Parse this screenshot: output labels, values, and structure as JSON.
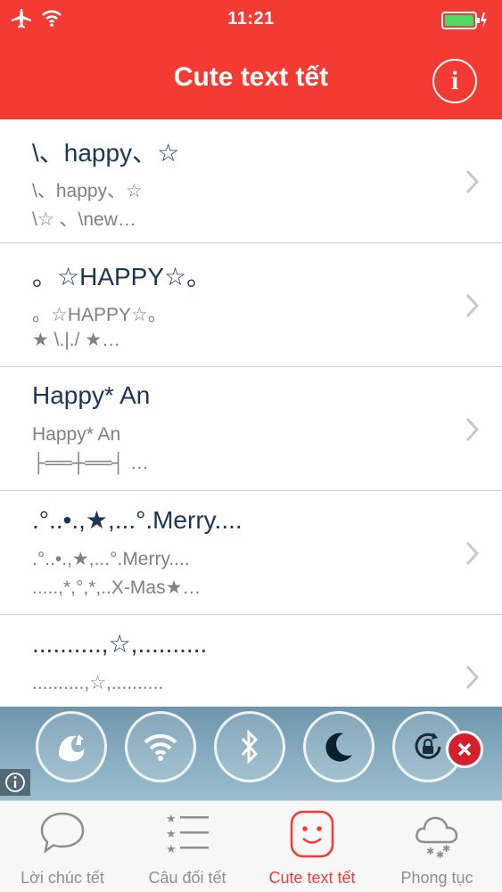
{
  "status": {
    "time": "11:21"
  },
  "nav": {
    "title": "Cute text tết",
    "info_label": "i"
  },
  "items": [
    {
      "title": "\\、happy、☆",
      "line1": "\\、happy、☆",
      "line2": "\\☆ 、\\new…"
    },
    {
      "title": "。☆HAPPY☆。",
      "line1": "。☆HAPPY☆。",
      "line2": "★   \\.|./   ★…"
    },
    {
      "title": "Happy* An",
      "line1": "Happy* An",
      "line2": "├══┼══┤ …"
    },
    {
      "title": ".°..•.,★,...°.Merry....",
      "line1": ".°..•.,★,...°.Merry....",
      "line2": ".....,*,°,*,..X-Mas★…"
    },
    {
      "title": "..........,☆,..........",
      "line1": "..........,☆,..........",
      "line2": ""
    }
  ],
  "overlay": {
    "buttons": [
      "uc-browser-icon",
      "wifi-icon",
      "bluetooth-icon",
      "moon-icon",
      "rotation-lock-icon"
    ],
    "close_color": "#d4202a"
  },
  "tabs": [
    {
      "label": "Lời chúc tết",
      "icon": "speech-bubble-icon"
    },
    {
      "label": "Câu đối tết",
      "icon": "star-list-icon"
    },
    {
      "label": "Cute text tết",
      "icon": "smiley-face-icon"
    },
    {
      "label": "Phong tục",
      "icon": "snow-cloud-icon"
    }
  ],
  "active_tab": 2,
  "colors": {
    "accent": "#f33b33",
    "title_text": "#1b3557",
    "subtitle_text": "#808080"
  }
}
